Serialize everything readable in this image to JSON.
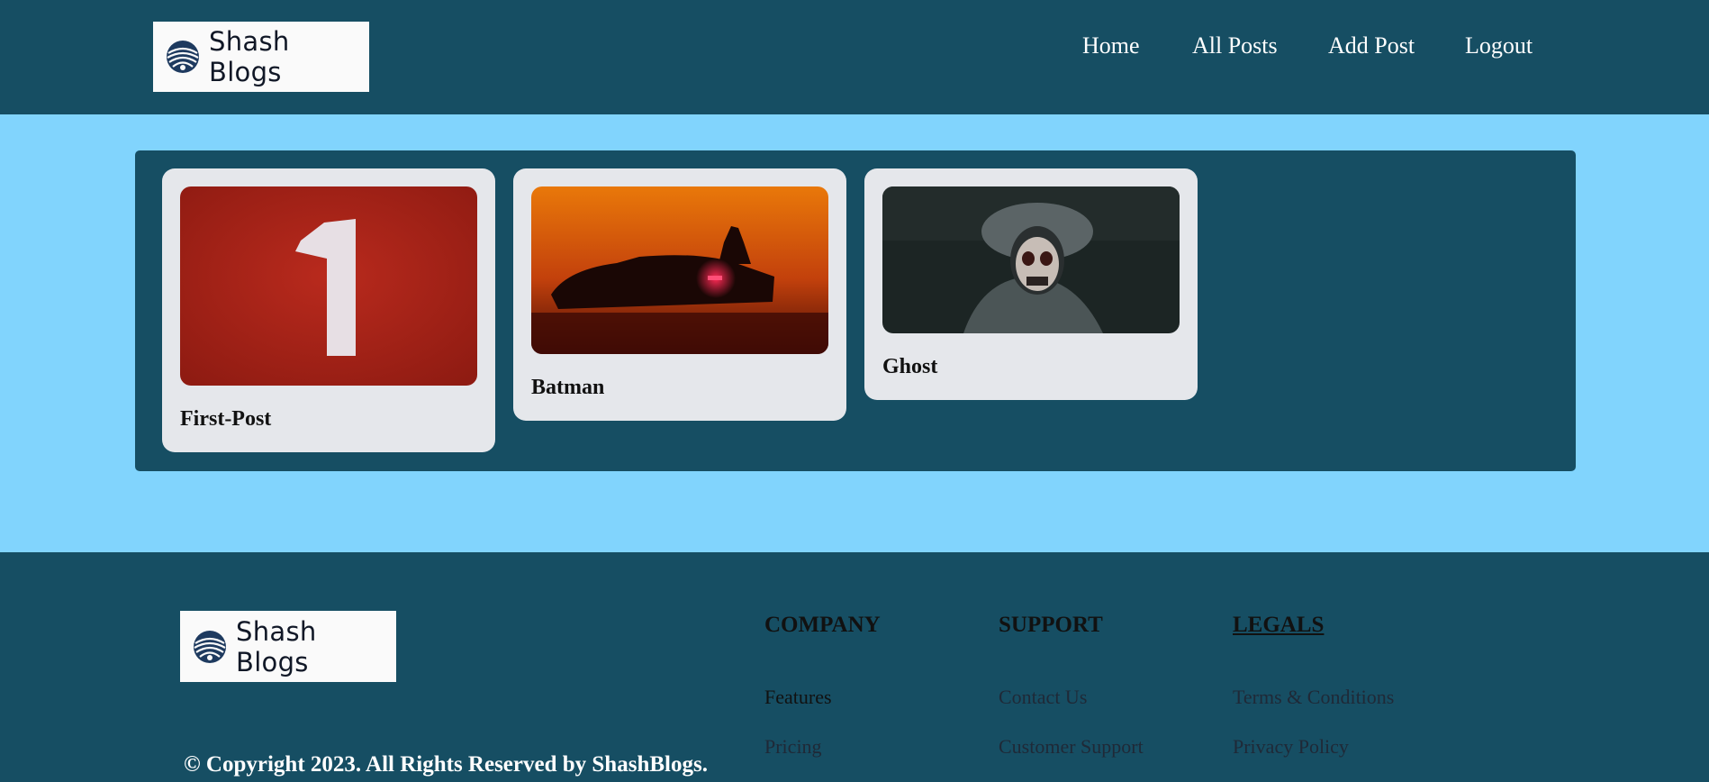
{
  "brand": {
    "name": "Shash Blogs",
    "icon": "globe-swirl-logo-icon"
  },
  "nav": {
    "items": [
      "Home",
      "All Posts",
      "Add Post",
      "Logout"
    ]
  },
  "posts": [
    {
      "title": "First-Post",
      "image": "red track with number 1"
    },
    {
      "title": "Batman",
      "image": "batmobile at orange sunset"
    },
    {
      "title": "Ghost",
      "image": "soldier with skull mask"
    }
  ],
  "footer": {
    "copyright": "© Copyright 2023. All Rights Reserved by ShashBlogs.",
    "columns": [
      {
        "heading": "COMPANY",
        "links": [
          "Features",
          "Pricing"
        ]
      },
      {
        "heading": "SUPPORT",
        "links": [
          "Contact Us",
          "Customer Support"
        ]
      },
      {
        "heading": "LEGALS",
        "links": [
          "Terms & Conditions",
          "Privacy Policy"
        ]
      }
    ]
  },
  "colors": {
    "header_bg": "#164e63",
    "page_bg": "#81d4fd",
    "card_bg": "#e5e7eb"
  }
}
